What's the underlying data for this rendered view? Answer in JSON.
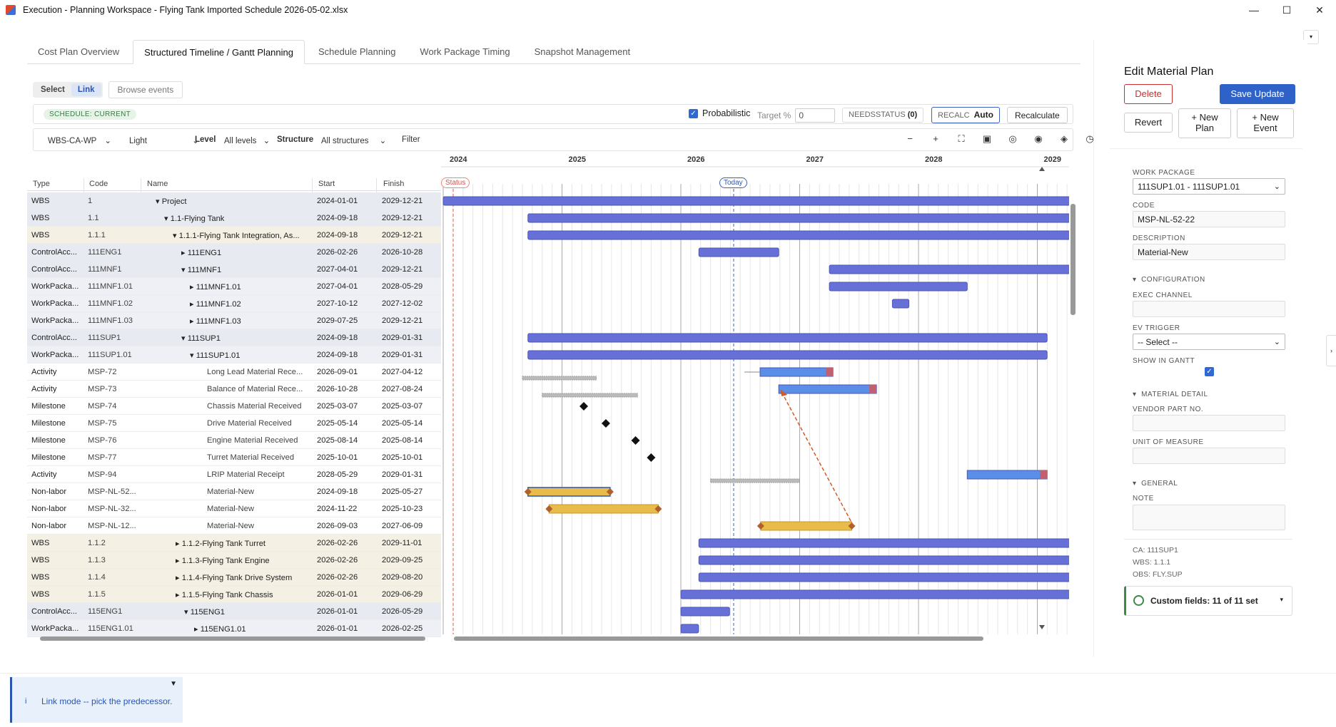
{
  "window": {
    "title": "Execution - Planning Workspace - Flying Tank Imported Schedule 2026-05-02.xlsx",
    "min": "—",
    "max": "☐",
    "close": "✕"
  },
  "tabs": [
    "Cost Plan Overview",
    "Structured Timeline / Gantt Planning",
    "Schedule Planning",
    "Work Package Timing",
    "Snapshot Management"
  ],
  "mode": {
    "select": "Select",
    "link": "Link",
    "browse": "Browse events"
  },
  "toolbar1": {
    "badge": "SCHEDULE: CURRENT",
    "prob": "Probabilistic",
    "target_label": "Target %",
    "target_val": "0",
    "needs_label": "NEEDSSTATUS",
    "needs_count": "(0)",
    "recalc_label": "RECALC",
    "recalc_val": "Auto",
    "recalc_btn": "Recalculate"
  },
  "toolbar2": {
    "wbs": "WBS-CA-WP",
    "theme": "Light",
    "level_label": "Level",
    "level_val": "All levels",
    "structure_label": "Structure",
    "structure_val": "All structures",
    "filter": "Filter"
  },
  "headers": {
    "type": "Type",
    "code": "Code",
    "name": "Name",
    "start": "Start",
    "finish": "Finish"
  },
  "years": [
    "2024",
    "2025",
    "2026",
    "2027",
    "2028",
    "2029"
  ],
  "status_label": "Status",
  "today_label": "Today",
  "rows": [
    {
      "type": "WBS",
      "code": "1",
      "name": "▾ Project",
      "start": "2024-01-01",
      "finish": "2029-12-21"
    },
    {
      "type": "WBS",
      "code": "1.1",
      "name": "▾ 1.1-Flying Tank",
      "start": "2024-09-18",
      "finish": "2029-12-21"
    },
    {
      "type": "WBS",
      "code": "1.1.1",
      "name": "▾ 1.1.1-Flying Tank Integration, As...",
      "start": "2024-09-18",
      "finish": "2029-12-21"
    },
    {
      "type": "ControlAcc...",
      "code": "111ENG1",
      "name": "▸ 111ENG1",
      "start": "2026-02-26",
      "finish": "2026-10-28"
    },
    {
      "type": "ControlAcc...",
      "code": "111MNF1",
      "name": "▾ 111MNF1",
      "start": "2027-04-01",
      "finish": "2029-12-21"
    },
    {
      "type": "WorkPacka...",
      "code": "111MNF1.01",
      "name": "▸ 111MNF1.01",
      "start": "2027-04-01",
      "finish": "2028-05-29"
    },
    {
      "type": "WorkPacka...",
      "code": "111MNF1.02",
      "name": "▸ 111MNF1.02",
      "start": "2027-10-12",
      "finish": "2027-12-02"
    },
    {
      "type": "WorkPacka...",
      "code": "111MNF1.03",
      "name": "▸ 111MNF1.03",
      "start": "2029-07-25",
      "finish": "2029-12-21"
    },
    {
      "type": "ControlAcc...",
      "code": "111SUP1",
      "name": "▾ 111SUP1",
      "start": "2024-09-18",
      "finish": "2029-01-31"
    },
    {
      "type": "WorkPacka...",
      "code": "111SUP1.01",
      "name": "▾ 111SUP1.01",
      "start": "2024-09-18",
      "finish": "2029-01-31"
    },
    {
      "type": "Activity",
      "code": "MSP-72",
      "name": "Long Lead Material Rece...",
      "start": "2026-09-01",
      "finish": "2027-04-12"
    },
    {
      "type": "Activity",
      "code": "MSP-73",
      "name": "Balance of Material Rece...",
      "start": "2026-10-28",
      "finish": "2027-08-24"
    },
    {
      "type": "Milestone",
      "code": "MSP-74",
      "name": "Chassis Material Received",
      "start": "2025-03-07",
      "finish": "2025-03-07"
    },
    {
      "type": "Milestone",
      "code": "MSP-75",
      "name": "Drive Material Received",
      "start": "2025-05-14",
      "finish": "2025-05-14"
    },
    {
      "type": "Milestone",
      "code": "MSP-76",
      "name": "Engine Material Received",
      "start": "2025-08-14",
      "finish": "2025-08-14"
    },
    {
      "type": "Milestone",
      "code": "MSP-77",
      "name": "Turret Material Received",
      "start": "2025-10-01",
      "finish": "2025-10-01"
    },
    {
      "type": "Activity",
      "code": "MSP-94",
      "name": "LRIP Material Receipt",
      "start": "2028-05-29",
      "finish": "2029-01-31"
    },
    {
      "type": "Non-labor",
      "code": "MSP-NL-52...",
      "name": "Material-New",
      "start": "2024-09-18",
      "finish": "2025-05-27"
    },
    {
      "type": "Non-labor",
      "code": "MSP-NL-32...",
      "name": "Material-New",
      "start": "2024-11-22",
      "finish": "2025-10-23"
    },
    {
      "type": "Non-labor",
      "code": "MSP-NL-12...",
      "name": "Material-New",
      "start": "2026-09-03",
      "finish": "2027-06-09"
    },
    {
      "type": "WBS",
      "code": "1.1.2",
      "name": "▸ 1.1.2-Flying Tank Turret",
      "start": "2026-02-26",
      "finish": "2029-11-01"
    },
    {
      "type": "WBS",
      "code": "1.1.3",
      "name": "▸ 1.1.3-Flying Tank Engine",
      "start": "2026-02-26",
      "finish": "2029-09-25"
    },
    {
      "type": "WBS",
      "code": "1.1.4",
      "name": "▸ 1.1.4-Flying Tank Drive System",
      "start": "2026-02-26",
      "finish": "2029-08-20"
    },
    {
      "type": "WBS",
      "code": "1.1.5",
      "name": "▸ 1.1.5-Flying Tank Chassis",
      "start": "2026-01-01",
      "finish": "2029-06-29"
    },
    {
      "type": "ControlAcc...",
      "code": "115ENG1",
      "name": "▾ 115ENG1",
      "start": "2026-01-01",
      "finish": "2026-05-29"
    },
    {
      "type": "WorkPacka...",
      "code": "115ENG1.01",
      "name": "▸ 115ENG1.01",
      "start": "2026-01-01",
      "finish": "2026-02-25"
    }
  ],
  "panel": {
    "title": "Edit Material Plan",
    "delete": "Delete",
    "save": "Save Update",
    "revert": "Revert",
    "new_plan": "+ New Plan",
    "new_event": "+ New Event",
    "wp_label": "WORK PACKAGE",
    "wp_val": "111SUP1.01 - 111SUP1.01",
    "code_label": "CODE",
    "code_val": "MSP-NL-52-22",
    "desc_label": "DESCRIPTION",
    "desc_val": "Material-New",
    "config": "CONFIGURATION",
    "exec_label": "EXEC CHANNEL",
    "ev_label": "EV TRIGGER",
    "ev_val": "-- Select --",
    "show_label": "SHOW IN GANTT",
    "matdetail": "MATERIAL DETAIL",
    "vendor_label": "VENDOR PART NO.",
    "uom_label": "UNIT OF MEASURE",
    "general": "GENERAL",
    "note_label": "NOTE",
    "ca": "CA: 111SUP1",
    "wbs": "WBS: 1.1.1",
    "obs": "OBS: FLY.SUP",
    "custom": "Custom fields: 11 of 11 set"
  },
  "toast": {
    "text": "Link mode -- pick the predecessor.",
    "icon": "i"
  },
  "colors": {
    "bar": "#6670d6",
    "gold": "#e8bb4a",
    "accent": "#2a55b0"
  }
}
